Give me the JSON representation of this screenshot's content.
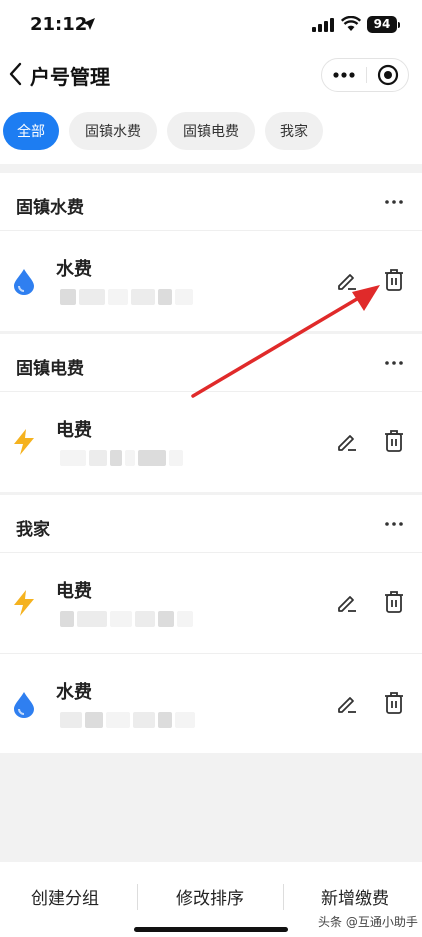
{
  "status_bar": {
    "time": "21:12",
    "battery": "94"
  },
  "nav": {
    "title": "户号管理"
  },
  "tabs": [
    {
      "label": "全部",
      "active": true
    },
    {
      "label": "固镇水费",
      "active": false
    },
    {
      "label": "固镇电费",
      "active": false
    },
    {
      "label": "我家",
      "active": false
    }
  ],
  "groups": [
    {
      "name": "固镇水费",
      "items": [
        {
          "title": "水费",
          "icon": "water-drop-icon"
        }
      ]
    },
    {
      "name": "固镇电费",
      "items": [
        {
          "title": "电费",
          "icon": "lightning-icon"
        }
      ]
    },
    {
      "name": "我家",
      "items": [
        {
          "title": "电费",
          "icon": "lightning-icon"
        },
        {
          "title": "水费",
          "icon": "water-drop-icon"
        }
      ]
    }
  ],
  "bottom_bar": {
    "create_group": "创建分组",
    "reorder": "修改排序",
    "add_payment": "新增缴费"
  },
  "watermark": "头条 @互通小助手",
  "colors": {
    "accent": "#1d7df2",
    "water": "#2f7ff0",
    "electric": "#f5b21e",
    "annotation_arrow": "#e02a2a"
  }
}
